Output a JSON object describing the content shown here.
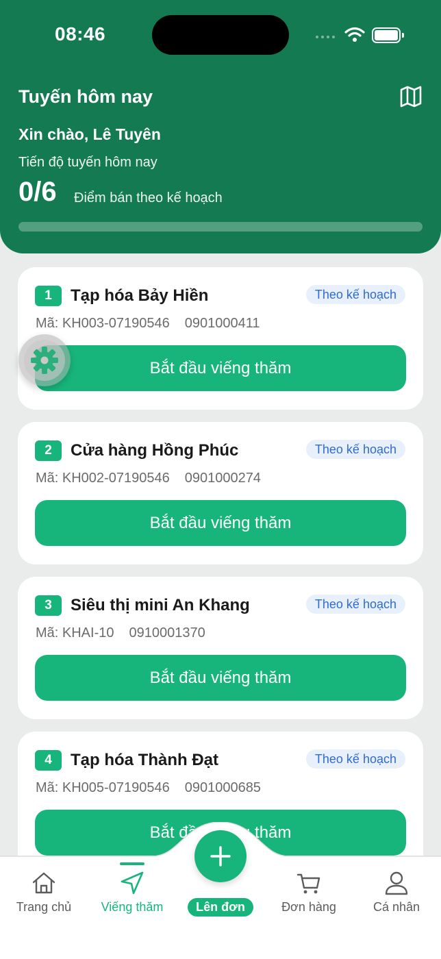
{
  "status_bar": {
    "time": "08:46"
  },
  "header": {
    "title": "Tuyến hôm nay",
    "greeting": "Xin chào, Lê Tuyên",
    "progress_label": "Tiến độ tuyến hôm nay",
    "progress_count": "0/6",
    "progress_desc": "Điểm bán theo kế hoạch",
    "progress_fraction": 0
  },
  "cards": [
    {
      "num": "1",
      "name": "Tạp hóa Bảy Hiền",
      "badge": "Theo kế hoạch",
      "code": "Mã: KH003-07190546",
      "phone": "0901000411",
      "button": "Bắt đầu viếng thăm"
    },
    {
      "num": "2",
      "name": "Cửa hàng Hồng Phúc",
      "badge": "Theo kế hoạch",
      "code": "Mã: KH002-07190546",
      "phone": "0901000274",
      "button": "Bắt đầu viếng thăm"
    },
    {
      "num": "3",
      "name": "Siêu thị mini An Khang",
      "badge": "Theo kế hoạch",
      "code": "Mã: KHAI-10",
      "phone": "0910001370",
      "button": "Bắt đầu viếng thăm"
    },
    {
      "num": "4",
      "name": "Tạp hóa Thành Đạt",
      "badge": "Theo kế hoạch",
      "code": "Mã: KH005-07190546",
      "phone": "0901000685",
      "button": "Bắt đầu viếng thăm"
    }
  ],
  "bottom_nav": {
    "items": [
      {
        "label": "Trang chủ",
        "icon": "home-icon"
      },
      {
        "label": "Viếng thăm",
        "icon": "navigation-arrow-icon",
        "active": true
      },
      {
        "label": "Lên đơn",
        "icon": "plus-icon"
      },
      {
        "label": "Đơn hàng",
        "icon": "cart-icon"
      },
      {
        "label": "Cá nhân",
        "icon": "user-icon"
      }
    ]
  },
  "colors": {
    "header": "#137a52",
    "accent": "#17b57c",
    "badge_bg": "#e8f0fb",
    "badge_text": "#2f6bd0"
  }
}
